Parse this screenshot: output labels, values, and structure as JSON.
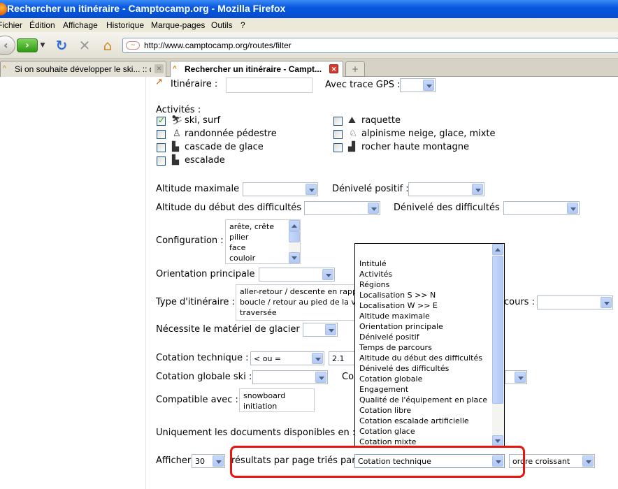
{
  "window": {
    "title": "Rechercher un itinéraire - Camptocamp.org - Mozilla Firefox"
  },
  "menu": {
    "items": [
      "Fichier",
      "Édition",
      "Affichage",
      "Historique",
      "Marque-pages",
      "Outils",
      "?"
    ]
  },
  "navbar": {
    "url": "http://www.camptocamp.org/routes/filter"
  },
  "tabs": [
    {
      "label": "Si on souhaite développer le ski... :: dis...",
      "active": false
    },
    {
      "label": "Rechercher un itinéraire - Campt...",
      "active": true
    }
  ],
  "form": {
    "itineraire_label": "Itinéraire :",
    "gps_label": "Avec trace GPS :",
    "activites_label": "Activités :",
    "activities": [
      {
        "label": "ski, surf",
        "checked": true,
        "icon": "skier-icon"
      },
      {
        "label": "raquette",
        "checked": false,
        "icon": "snowshoe-icon"
      },
      {
        "label": "randonnée pédestre",
        "checked": false,
        "icon": "hiker-icon"
      },
      {
        "label": "alpinisme neige, glace, mixte",
        "checked": false,
        "icon": "mountaineer-icon"
      },
      {
        "label": "cascade de glace",
        "checked": false,
        "icon": "icefall-icon"
      },
      {
        "label": "rocher haute montagne",
        "checked": false,
        "icon": "rock-icon"
      },
      {
        "label": "escalade",
        "checked": false,
        "icon": "climber-icon"
      }
    ],
    "altitude_max_label": "Altitude maximale :",
    "denivele_positif_label": "Dénivelé positif :",
    "altitude_debut_label": "Altitude du début des difficultés :",
    "denivele_diff_label": "Dénivelé des difficultés :",
    "configuration_label": "Configuration :",
    "configuration_options": [
      "arête, crête",
      "pilier",
      "face",
      "couloir"
    ],
    "orientation_label": "Orientation principale :",
    "type_label": "Type d'itinéraire :",
    "type_options": [
      "aller-retour / descente en rapp",
      "boucle / retour au pied de la vo",
      "traversée"
    ],
    "parcours_label": "cours :",
    "glacier_label": "Nécessite le matériel de glacier :",
    "cotation_tech_label": "Cotation technique :",
    "cotation_tech_op": "< ou =",
    "cotation_tech_val": "2.1",
    "cotation_ski_label": "Cotation globale ski :",
    "cotation_partial": "Co",
    "compatible_label": "Compatible avec :",
    "compatible_options": [
      "snowboard",
      "initiation"
    ],
    "uniquement_label": "Uniquement les documents disponibles en :",
    "afficher_label": "Afficher",
    "afficher_value": "30",
    "resultats_label": "résultats par page triés par",
    "sort_value": "Cotation technique",
    "order_value": "ordre croissant"
  },
  "sort_dropdown": {
    "options": [
      "Intitulé",
      "Activités",
      "Régions",
      "Localisation S >> N",
      "Localisation W >> E",
      "Altitude maximale",
      "Orientation principale",
      "Dénivelé positif",
      "Temps de parcours",
      "Altitude du début des difficultés",
      "Dénivelé des difficultés",
      "Cotation globale",
      "Engagement",
      "Qualité de l'équipement en place",
      "Cotation libre",
      "Cotation escalade artificielle",
      "Cotation glace",
      "Cotation mixte",
      "Cotation technique"
    ],
    "highlighted": "Cotation technique"
  }
}
